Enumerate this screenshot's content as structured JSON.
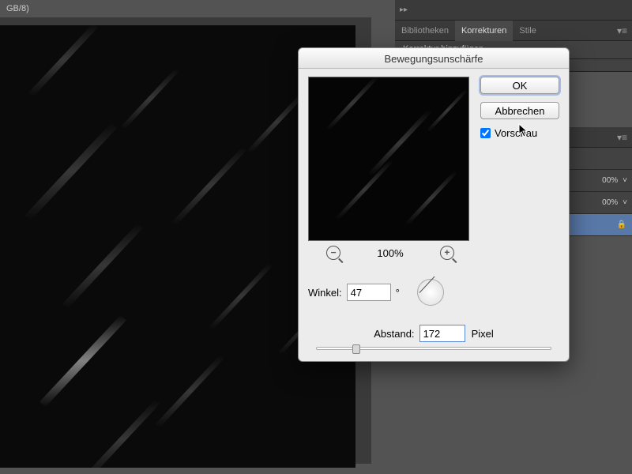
{
  "tab_label": "GB/8)",
  "panels": {
    "expand": "▸▸",
    "tabs": [
      "Bibliotheken",
      "Korrekturen",
      "Stile"
    ],
    "active_tab_index": 1,
    "sub_label": "Korrektur hinzufügen",
    "flyout": "▾≡",
    "layer_pct": "00%",
    "layer_pct2": "00%"
  },
  "dialog": {
    "title": "Bewegungsunschärfe",
    "ok": "OK",
    "cancel": "Abbrechen",
    "preview_label": "Vorschau",
    "preview_checked": true,
    "zoom_pct": "100%",
    "zoom_out": "−",
    "zoom_in": "+",
    "angle_label": "Winkel:",
    "angle_value": "47",
    "angle_deg": "°",
    "distance_label": "Abstand:",
    "distance_value": "172",
    "distance_unit": "Pixel",
    "slider_pos_pct": 17
  },
  "lock_icon": "🔒"
}
